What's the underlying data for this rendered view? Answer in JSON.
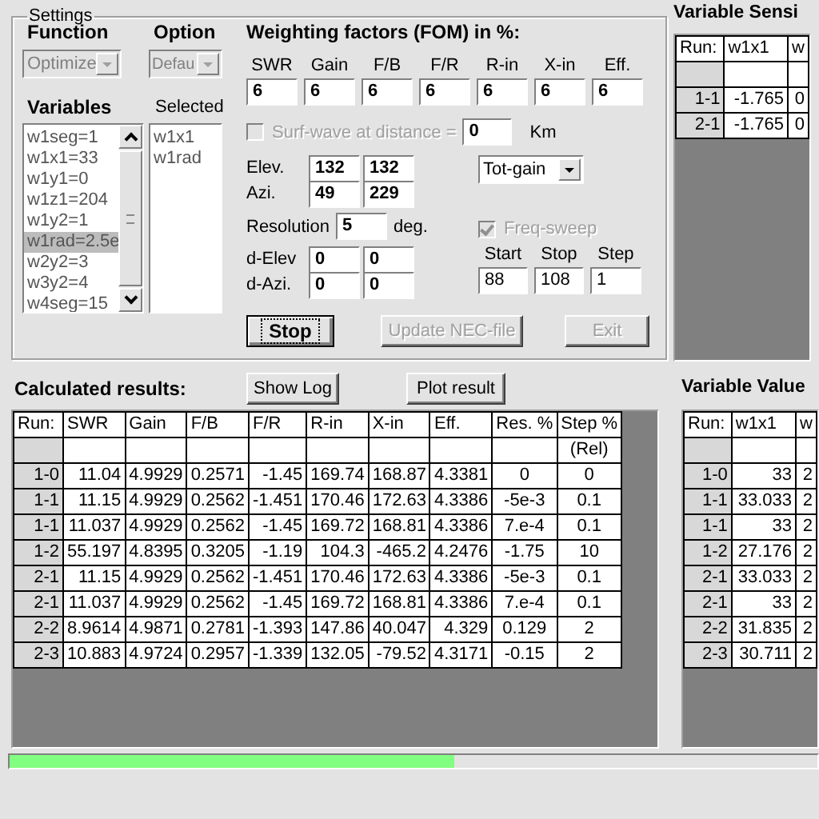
{
  "settings": {
    "title": "Settings",
    "function": {
      "label": "Function",
      "value": "Optimize",
      "disabled": true
    },
    "option": {
      "label": "Option",
      "value": "Defau",
      "disabled": true
    },
    "variables": {
      "label": "Variables",
      "items": [
        {
          "text": "w1seg=1",
          "selected": false
        },
        {
          "text": "w1x1=33",
          "selected": false
        },
        {
          "text": "w1y1=0",
          "selected": false
        },
        {
          "text": "w1z1=204",
          "selected": false
        },
        {
          "text": "w1y2=1",
          "selected": false
        },
        {
          "text": "w1rad=2.5e",
          "selected": true
        },
        {
          "text": "w2y2=3",
          "selected": false
        },
        {
          "text": "w3y2=4",
          "selected": false
        },
        {
          "text": "w4seg=15",
          "selected": false
        }
      ]
    },
    "selected": {
      "label": "Selected",
      "items": [
        "w1x1",
        "w1rad"
      ]
    },
    "weighting": {
      "title": "Weighting factors (FOM) in %:",
      "fields": [
        {
          "label": "SWR",
          "value": "6"
        },
        {
          "label": "Gain",
          "value": "6"
        },
        {
          "label": "F/B",
          "value": "6"
        },
        {
          "label": "F/R",
          "value": "6"
        },
        {
          "label": "R-in",
          "value": "6"
        },
        {
          "label": "X-in",
          "value": "6"
        },
        {
          "label": "Eff.",
          "value": "6"
        }
      ]
    },
    "surf_wave": {
      "label": "Surf-wave at distance =",
      "checked": false,
      "disabled": true,
      "value": "0",
      "unit": "Km"
    },
    "angles": [
      {
        "label": "Elev.",
        "values": [
          "132",
          "132"
        ]
      },
      {
        "label": "Azi.",
        "values": [
          "49",
          "229"
        ]
      }
    ],
    "resolution": {
      "label": "Resolution",
      "value": "5",
      "unit": "deg."
    },
    "deltas": [
      {
        "label": "d-Elev",
        "values": [
          "0",
          "0"
        ]
      },
      {
        "label": "d-Azi.",
        "values": [
          "0",
          "0"
        ]
      }
    ],
    "gain_type": {
      "value": "Tot-gain"
    },
    "freq_sweep": {
      "label": "Freq-sweep",
      "checked": true,
      "disabled": true,
      "fields": [
        {
          "label": "Start",
          "value": "88"
        },
        {
          "label": "Stop",
          "value": "108"
        },
        {
          "label": "Step",
          "value": "1"
        }
      ]
    },
    "buttons": [
      {
        "label": "Stop",
        "disabled": false,
        "focused": true
      },
      {
        "label": "Update NEC-file",
        "disabled": true,
        "focused": false
      },
      {
        "label": "Exit",
        "disabled": true,
        "focused": false
      }
    ]
  },
  "sensitivity": {
    "title": "Variable Sensi",
    "columns": [
      "Run:",
      "w1x1",
      "w"
    ],
    "rows": [
      [
        "1-1",
        "-1.765",
        "0"
      ],
      [
        "2-1",
        "-1.765",
        "0"
      ]
    ]
  },
  "results": {
    "title": "Calculated results:",
    "buttons": [
      "Show Log",
      "Plot result"
    ],
    "columns": [
      "Run:",
      "SWR",
      "Gain",
      "F/B",
      "F/R",
      "R-in",
      "X-in",
      "Eff.",
      "Res. %",
      "Step %"
    ],
    "step_unit": "(Rel)",
    "rows": [
      [
        "1-0",
        "11.04",
        "4.9929",
        "0.2571",
        "-1.45",
        "169.74",
        "168.87",
        "4.3381",
        "0",
        "0"
      ],
      [
        "1-1",
        "11.15",
        "4.9929",
        "0.2562",
        "-1.451",
        "170.46",
        "172.63",
        "4.3386",
        "-5e-3",
        "0.1"
      ],
      [
        "1-1",
        "11.037",
        "4.9929",
        "0.2562",
        "-1.45",
        "169.72",
        "168.81",
        "4.3386",
        "7.e-4",
        "0.1"
      ],
      [
        "1-2",
        "55.197",
        "4.8395",
        "0.3205",
        "-1.19",
        "104.3",
        "-465.2",
        "4.2476",
        "-1.75",
        "10"
      ],
      [
        "2-1",
        "11.15",
        "4.9929",
        "0.2562",
        "-1.451",
        "170.46",
        "172.63",
        "4.3386",
        "-5e-3",
        "0.1"
      ],
      [
        "2-1",
        "11.037",
        "4.9929",
        "0.2562",
        "-1.45",
        "169.72",
        "168.81",
        "4.3386",
        "7.e-4",
        "0.1"
      ],
      [
        "2-2",
        "8.9614",
        "4.9871",
        "0.2781",
        "-1.393",
        "147.86",
        "40.047",
        "4.329",
        "0.129",
        "2"
      ],
      [
        "2-3",
        "10.883",
        "4.9724",
        "0.2957",
        "-1.339",
        "132.05",
        "-79.52",
        "4.3171",
        "-0.15",
        "2"
      ]
    ]
  },
  "values": {
    "title": "Variable Value",
    "columns": [
      "Run:",
      "w1x1",
      "w"
    ],
    "rows": [
      [
        "1-0",
        "33",
        "2"
      ],
      [
        "1-1",
        "33.033",
        "2"
      ],
      [
        "1-1",
        "33",
        "2"
      ],
      [
        "1-2",
        "27.176",
        "2"
      ],
      [
        "2-1",
        "33.033",
        "2"
      ],
      [
        "2-1",
        "33",
        "2"
      ],
      [
        "2-2",
        "31.835",
        "2"
      ],
      [
        "2-3",
        "30.711",
        "2"
      ]
    ]
  },
  "progress": {
    "level": 0.55
  }
}
